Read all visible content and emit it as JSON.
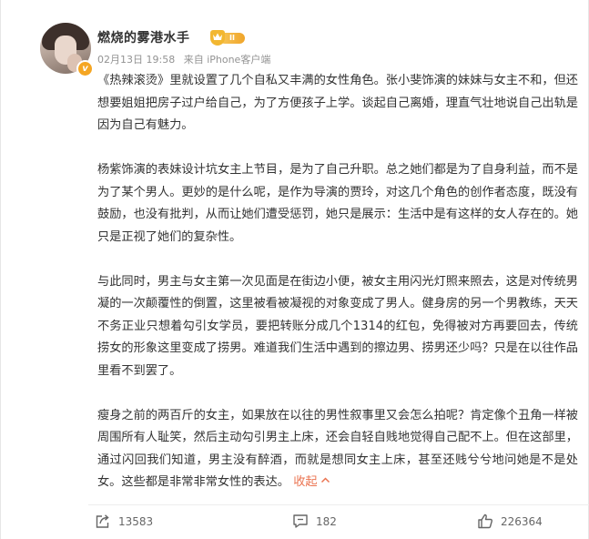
{
  "post": {
    "author": {
      "name": "燃烧的雾港水手",
      "level_label": "II",
      "verified_mark": "v"
    },
    "meta": {
      "date": "02月13日 19:58",
      "source": "来自 iPhone客户端"
    },
    "paragraphs": [
      "《热辣滚烫》里就设置了几个自私又丰满的女性角色。张小斐饰演的妹妹与女主不和，但还想要姐姐把房子过户给自己，为了方便孩子上学。谈起自己离婚，理直气壮地说自己出轨是因为自己有魅力。",
      "杨紫饰演的表妹设计坑女主上节目，是为了自己升职。总之她们都是为了自身利益，而不是为了某个男人。更妙的是什么呢，是作为导演的贾玲，对这几个角色的创作者态度，既没有鼓励，也没有批判，从而让她们遭受惩罚，她只是展示：生活中是有这样的女人存在的。她只是正视了她们的复杂性。",
      "与此同时，男主与女主第一次见面是在街边小便，被女主用闪光灯照来照去，这是对传统男凝的一次颠覆性的倒置，这里被看被凝视的对象变成了男人。健身房的另一个男教练，天天不务正业只想着勾引女学员，要把转账分成几个1314的红包，免得被对方再要回去，传统捞女的形象这里变成了捞男。难道我们生活中遇到的擦边男、捞男还少吗？只是在以往作品里看不到罢了。",
      "瘦身之前的两百斤的女主，如果放在以往的男性叙事里又会怎么拍呢？肯定像个丑角一样被周围所有人耻笑，然后主动勾引男主上床，还会自轻自贱地觉得自己配不上。但在这部里，通过闪回我们知道，男主没有醉酒，而就是想同女主上床，甚至还贱兮兮地问她是不是处女。这些都是非常非常女性的表达。"
    ],
    "collapse_label": "收起",
    "collapse_icon": "chevron-up-icon"
  },
  "actions": {
    "repost_count": "13583",
    "comment_count": "182",
    "like_count": "226364",
    "icons": [
      "repost-icon",
      "comment-icon",
      "like-icon"
    ]
  },
  "colors": {
    "text": "#333333",
    "meta": "#939393",
    "accent_orange": "#eb7350",
    "badge_gold": "#f5a623"
  }
}
